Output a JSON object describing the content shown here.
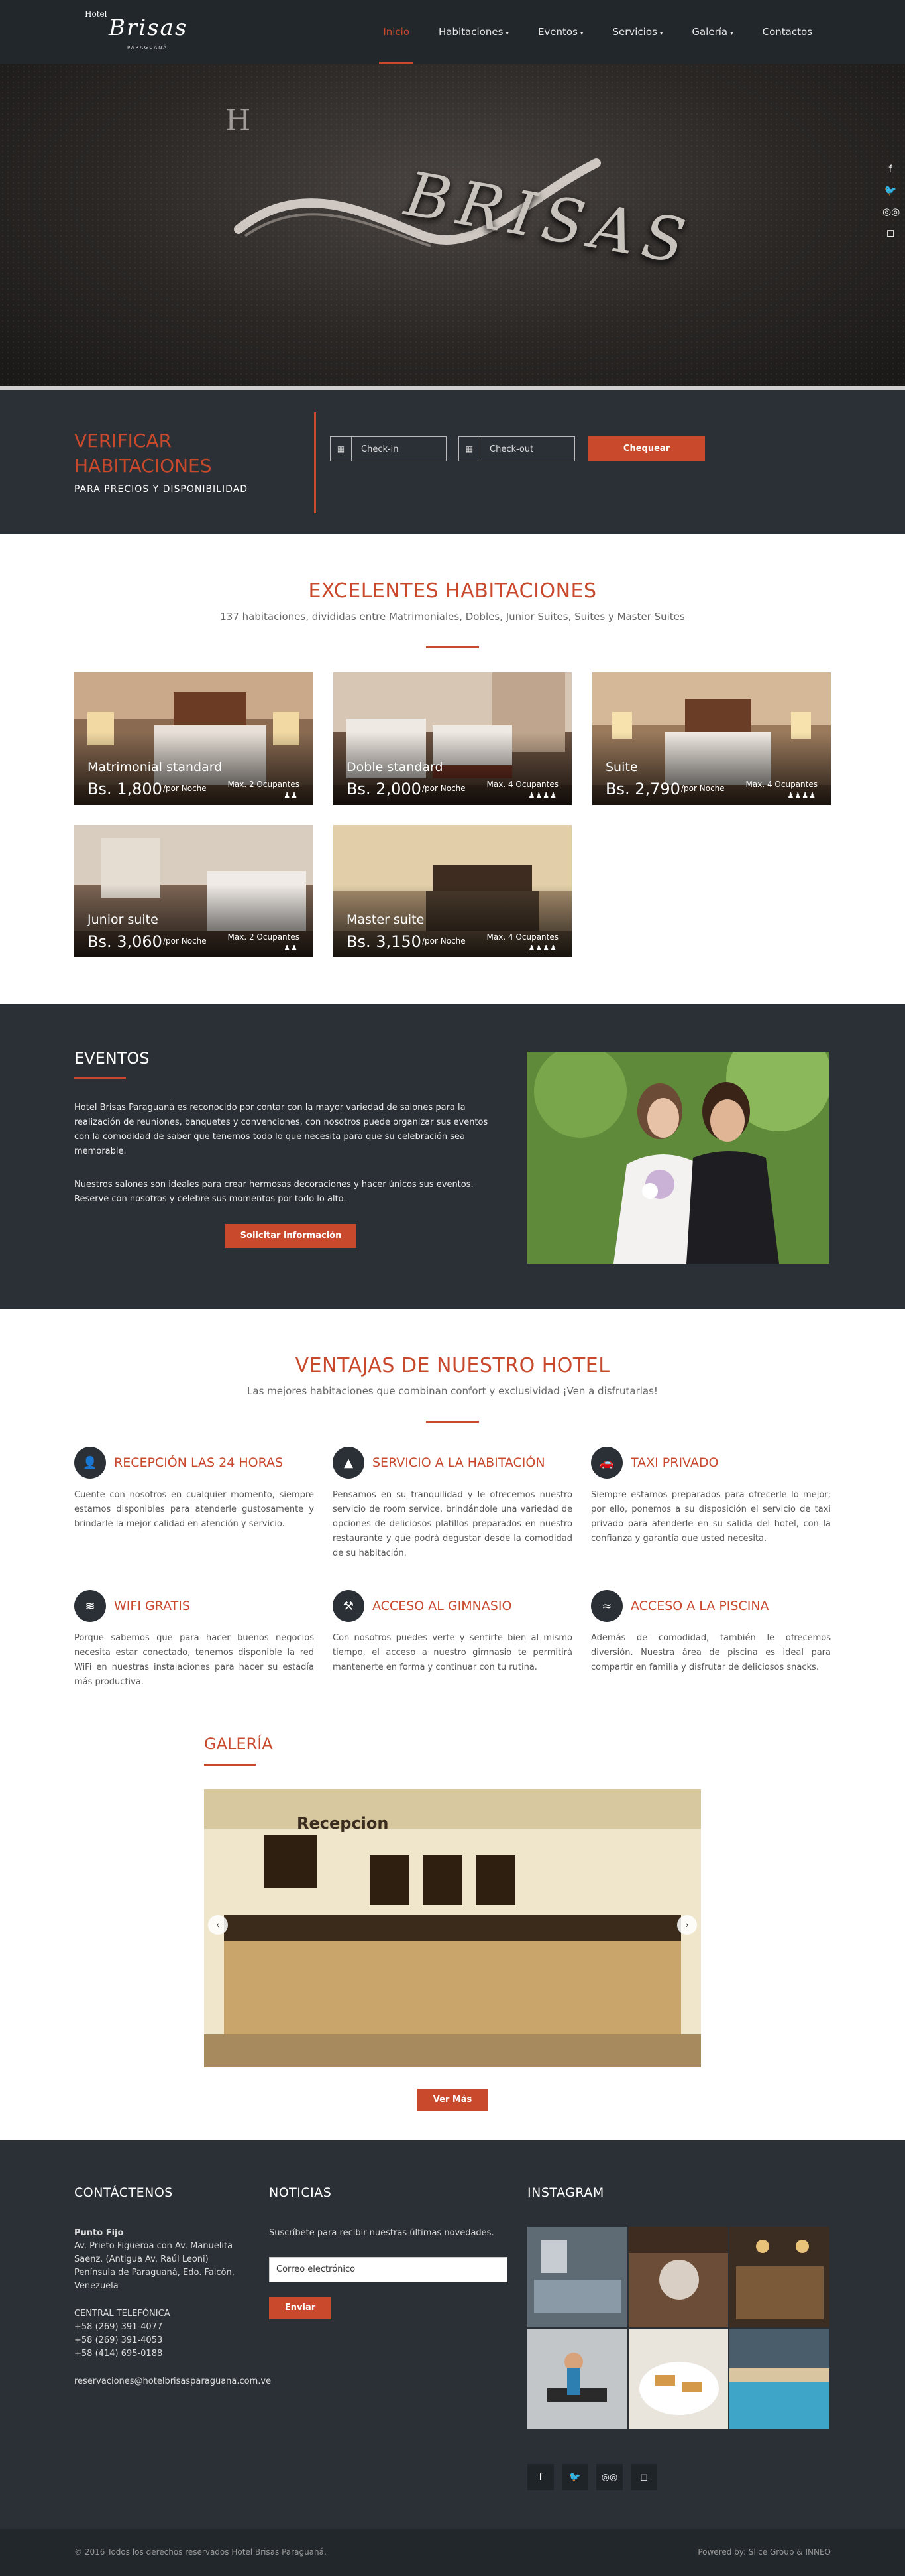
{
  "nav": {
    "logo_small": "Hotel",
    "logo_big": "Brisas",
    "logo_sub": "PARAGUANÁ",
    "items": [
      {
        "label": "Inicio",
        "caret": ""
      },
      {
        "label": "Habitaciones",
        "caret": "▾"
      },
      {
        "label": "Eventos",
        "caret": "▾"
      },
      {
        "label": "Servicios",
        "caret": "▾"
      },
      {
        "label": "Galería",
        "caret": "▾"
      },
      {
        "label": "Contactos",
        "caret": ""
      }
    ]
  },
  "hero": {
    "letter": "H",
    "brand": "BRISAS"
  },
  "social": {
    "facebook": "f",
    "twitter": "🐦",
    "tripadvisor": "◎◎",
    "instagram": "◻"
  },
  "booking": {
    "title_line1": "VERIFICAR",
    "title_line2": "HABITACIONES",
    "subtitle": "PARA PRECIOS Y DISPONIBILIDAD",
    "checkin_placeholder": "Check-in",
    "checkout_placeholder": "Check-out",
    "button": "Chequear"
  },
  "rooms": {
    "title": "EXCELENTES HABITACIONES",
    "subtitle": "137 habitaciones, divididas entre Matrimoniales, Dobles, Junior Suites, Suites y Master Suites",
    "items": [
      {
        "name": "Matrimonial standard",
        "price": "Bs. 1,800",
        "per": "/por Noche",
        "occ": "Max. 2 Ocupantes",
        "icons": "♟♟"
      },
      {
        "name": "Doble standard",
        "price": "Bs. 2,000",
        "per": "/por Noche",
        "occ": "Max. 4 Ocupantes",
        "icons": "♟♟♟♟"
      },
      {
        "name": "Suite",
        "price": "Bs. 2,790",
        "per": "/por Noche",
        "occ": "Max. 4 Ocupantes",
        "icons": "♟♟♟♟"
      },
      {
        "name": "Junior suite",
        "price": "Bs. 3,060",
        "per": "/por Noche",
        "occ": "Max. 2 Ocupantes",
        "icons": "♟♟"
      },
      {
        "name": "Master suite",
        "price": "Bs. 3,150",
        "per": "/por Noche",
        "occ": "Max. 4 Ocupantes",
        "icons": "♟♟♟♟"
      }
    ]
  },
  "events": {
    "title": "EVENTOS",
    "p1": "Hotel Brisas Paraguaná es reconocido por contar con la mayor variedad de salones para la realización de reuniones, banquetes y convenciones, con nosotros puede organizar sus eventos con la comodidad de saber que tenemos todo lo que necesita para que su celebración sea memorable.",
    "p2": "Nuestros salones son ideales para crear hermosas decoraciones y hacer únicos sus eventos. Reserve con nosotros y celebre sus momentos por todo lo alto.",
    "button": "Solicitar información"
  },
  "advantages": {
    "title": "VENTAJAS DE NUESTRO HOTEL",
    "subtitle": "Las mejores habitaciones que combinan confort y exclusividad ¡Ven a disfrutarlas!",
    "items": [
      {
        "icon": "👤",
        "title": "RECEPCIÓN LAS 24 HORAS",
        "text": "Cuente con nosotros en cualquier momento, siempre estamos disponibles para atenderle gustosamente y brindarle la mejor calidad en atención y servicio."
      },
      {
        "icon": "▲",
        "title": "SERVICIO A LA HABITACIÓN",
        "text": "Pensamos en su tranquilidad y le ofrecemos nuestro servicio de room service, brindándole una variedad de opciones de deliciosos platillos preparados en nuestro restaurante y que podrá degustar desde la comodidad de su habitación."
      },
      {
        "icon": "🚗",
        "title": "TAXI PRIVADO",
        "text": "Siempre estamos preparados para ofrecerle lo mejor; por ello, ponemos a su disposición el servicio de taxi privado para atenderle en su salida del hotel, con la confianza y garantía que usted necesita."
      },
      {
        "icon": "≋",
        "title": "WIFI GRATIS",
        "text": "Porque sabemos que para hacer buenos negocios necesita estar conectado, tenemos disponible la red WiFi en nuestras instalaciones para hacer su estadía más productiva."
      },
      {
        "icon": "⚒",
        "title": "ACCESO AL GIMNASIO",
        "text": "Con nosotros puedes verte y sentirte bien al mismo tiempo, el acceso a nuestro gimnasio te permitirá mantenerte en forma y continuar con tu rutina."
      },
      {
        "icon": "≈",
        "title": "ACCESO A LA PISCINA",
        "text": "Además de comodidad, también le ofrecemos diversión. Nuestra área de piscina es ideal para compartir en familia y disfrutar de deliciosos snacks."
      }
    ]
  },
  "gallery": {
    "title": "GALERÍA",
    "sign": "Recepcion",
    "prev": "‹",
    "next": "›",
    "button": "Ver Más"
  },
  "footer": {
    "contact_title": "CONTÁCTENOS",
    "address_label": "Punto Fijo",
    "address": "Av. Prieto Figueroa con Av. Manuelita Saenz. (Antigua Av. Raúl Leoni) Península de Paraguaná, Edo. Falcón, Venezuela",
    "phone_label": "CENTRAL TELEFÓNICA",
    "phone1": "+58 (269) 391-4077",
    "phone2": "+58 (269) 391-4053",
    "phone3": "+58 (414) 695-0188",
    "email_addr": "reservaciones@hotelbrisasparaguana.com.ve",
    "news_title": "NOTICIAS",
    "news_text": "Suscríbete para recibir nuestras últimas novedades.",
    "email_placeholder": "Correo electrónico",
    "send": "Enviar",
    "ig_title": "INSTAGRAM"
  },
  "bottom": {
    "copyright": "© 2016 Todos los derechos reservados Hotel Brisas Paraguaná.",
    "powered": "Powered by: Slice Group & INNEO"
  }
}
